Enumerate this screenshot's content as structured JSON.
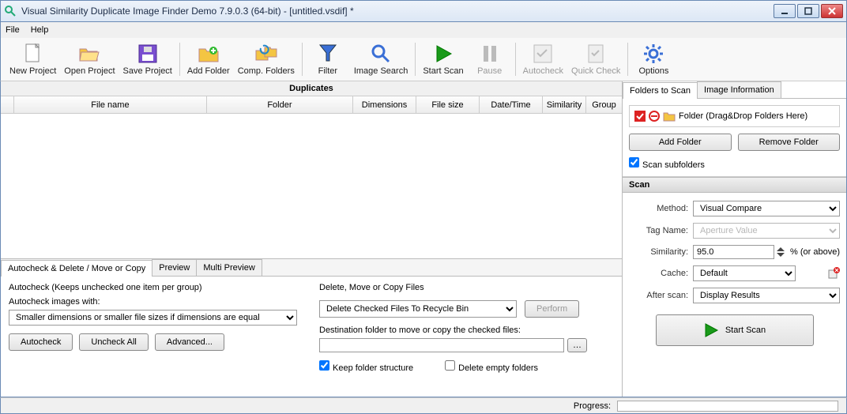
{
  "window": {
    "title": "Visual Similarity Duplicate Image Finder Demo 7.9.0.3 (64-bit) - [untitled.vsdif] *"
  },
  "menu": {
    "file": "File",
    "help": "Help"
  },
  "toolbar": {
    "new_project": "New Project",
    "open_project": "Open Project",
    "save_project": "Save Project",
    "add_folder": "Add Folder",
    "comp_folders": "Comp. Folders",
    "filter": "Filter",
    "image_search": "Image Search",
    "start_scan": "Start Scan",
    "pause": "Pause",
    "autocheck": "Autocheck",
    "quick_check": "Quick Check",
    "options": "Options"
  },
  "grid": {
    "title": "Duplicates",
    "cols": {
      "filename": "File name",
      "folder": "Folder",
      "dimensions": "Dimensions",
      "filesize": "File size",
      "datetime": "Date/Time",
      "similarity": "Similarity",
      "group": "Group"
    }
  },
  "bottom": {
    "tabs": {
      "autocheck": "Autocheck & Delete / Move or Copy",
      "preview": "Preview",
      "multi_preview": "Multi Preview"
    },
    "autocheck_desc": "Autocheck (Keeps unchecked one item per group)",
    "autocheck_with": "Autocheck images with:",
    "autocheck_rule": "Smaller dimensions or smaller file sizes if dimensions are equal",
    "btn_autocheck": "Autocheck",
    "btn_uncheck": "Uncheck All",
    "btn_advanced": "Advanced...",
    "dmc_title": "Delete, Move or Copy Files",
    "dmc_action": "Delete Checked Files To Recycle Bin",
    "btn_perform": "Perform",
    "dest_label": "Destination folder to move or copy the checked files:",
    "keep_structure": "Keep folder structure",
    "delete_empty": "Delete empty folders"
  },
  "right": {
    "tabs": {
      "folders": "Folders to Scan",
      "image_info": "Image Information"
    },
    "drop_hint": "Folder (Drag&Drop Folders Here)",
    "btn_add": "Add Folder",
    "btn_remove": "Remove Folder",
    "scan_subfolders": "Scan subfolders",
    "scan_head": "Scan",
    "method_label": "Method:",
    "method": "Visual Compare",
    "tag_label": "Tag Name:",
    "tag": "Aperture Value",
    "similarity_label": "Similarity:",
    "similarity_value": "95.0",
    "similarity_suffix": "%  (or above)",
    "cache_label": "Cache:",
    "cache": "Default",
    "after_label": "After scan:",
    "after": "Display Results",
    "btn_start": "Start Scan"
  },
  "status": {
    "progress_label": "Progress:"
  }
}
